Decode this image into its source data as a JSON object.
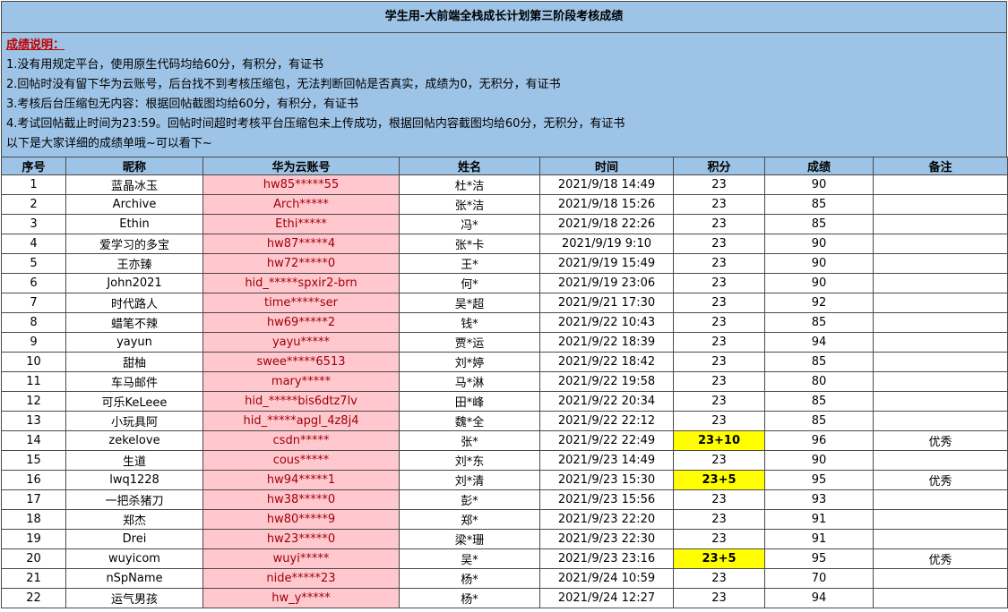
{
  "title": "学生用-大前端全栈成长计划第三阶段考核成绩",
  "notes": {
    "heading": "成绩说明：",
    "lines": [
      "1.没有用规定平台，使用原生代码均给60分，有积分，有证书",
      "2.回帖时没有留下华为云账号，后台找不到考核压缩包，无法判断回帖是否真实，成绩为0，无积分，有证书",
      "3.考核后台压缩包无内容：根据回帖截图均给60分，有积分，有证书",
      "4.考试回帖截止时间为23:59。回帖时间超时考核平台压缩包未上传成功，根据回帖内容截图均给60分，无积分，有证书",
      "以下是大家详细的成绩单哦~可以看下~"
    ]
  },
  "columns": [
    "序号",
    "昵称",
    "华为云账号",
    "姓名",
    "时间",
    "积分",
    "成绩",
    "备注"
  ],
  "rows": [
    {
      "no": "1",
      "nick": "蓝晶冰玉",
      "account": "hw85*****55",
      "name": "杜*洁",
      "time": "2021/9/18 14:49",
      "points": "23",
      "score": "90",
      "remark": ""
    },
    {
      "no": "2",
      "nick": "Archive",
      "account": "Arch*****",
      "name": "张*洁",
      "time": "2021/9/18 15:26",
      "points": "23",
      "score": "85",
      "remark": ""
    },
    {
      "no": "3",
      "nick": "Ethin",
      "account": "Ethi*****",
      "name": "冯*",
      "time": "2021/9/18 22:26",
      "points": "23",
      "score": "85",
      "remark": ""
    },
    {
      "no": "4",
      "nick": "爱学习的多宝",
      "account": "hw87*****4",
      "name": "张*卡",
      "time": "2021/9/19 9:10",
      "points": "23",
      "score": "90",
      "remark": ""
    },
    {
      "no": "5",
      "nick": "王亦臻",
      "account": "hw72*****0",
      "name": "王*",
      "time": "2021/9/19 15:49",
      "points": "23",
      "score": "90",
      "remark": ""
    },
    {
      "no": "6",
      "nick": "John2021",
      "account": "hid_*****spxir2-brn",
      "name": "何*",
      "time": "2021/9/19 23:06",
      "points": "23",
      "score": "90",
      "remark": ""
    },
    {
      "no": "7",
      "nick": "时代路人",
      "account": "time*****ser",
      "name": "吴*超",
      "time": "2021/9/21 17:30",
      "points": "23",
      "score": "92",
      "remark": ""
    },
    {
      "no": "8",
      "nick": "蜡笔不辣",
      "account": "hw69*****2",
      "name": "钱*",
      "time": "2021/9/22 10:43",
      "points": "23",
      "score": "85",
      "remark": ""
    },
    {
      "no": "9",
      "nick": "yayun",
      "account": "yayu*****",
      "name": "贾*运",
      "time": "2021/9/22 18:39",
      "points": "23",
      "score": "94",
      "remark": ""
    },
    {
      "no": "10",
      "nick": "甜柚",
      "account": "swee*****6513",
      "name": "刘*婷",
      "time": "2021/9/22 18:42",
      "points": "23",
      "score": "85",
      "remark": ""
    },
    {
      "no": "11",
      "nick": "车马邮件",
      "account": "mary*****",
      "name": "马*淋",
      "time": "2021/9/22 19:58",
      "points": "23",
      "score": "80",
      "remark": ""
    },
    {
      "no": "12",
      "nick": "可乐KeLeee",
      "account": "hid_*****bis6dtz7lv",
      "name": "田*峰",
      "time": "2021/9/22 20:34",
      "points": "23",
      "score": "85",
      "remark": ""
    },
    {
      "no": "13",
      "nick": "小玩具阿",
      "account": "hid_*****apgl_4z8j4",
      "name": "魏*全",
      "time": "2021/9/22 22:12",
      "points": "23",
      "score": "85",
      "remark": ""
    },
    {
      "no": "14",
      "nick": "zekelove",
      "account": "csdn*****",
      "name": "张*",
      "time": "2021/9/22 22:49",
      "points": "23+10",
      "score": "96",
      "remark": "优秀",
      "highlight": true
    },
    {
      "no": "15",
      "nick": "生道",
      "account": "cous*****",
      "name": "刘*东",
      "time": "2021/9/23 14:49",
      "points": "23",
      "score": "90",
      "remark": ""
    },
    {
      "no": "16",
      "nick": "lwq1228",
      "account": "hw94*****1",
      "name": "刘*清",
      "time": "2021/9/23 15:30",
      "points": "23+5",
      "score": "95",
      "remark": "优秀",
      "highlight": true
    },
    {
      "no": "17",
      "nick": "一把杀猪刀",
      "account": "hw38*****0",
      "name": "彭*",
      "time": "2021/9/23 15:56",
      "points": "23",
      "score": "93",
      "remark": ""
    },
    {
      "no": "18",
      "nick": "郑杰",
      "account": "hw80*****9",
      "name": "郑*",
      "time": "2021/9/23 22:20",
      "points": "23",
      "score": "91",
      "remark": ""
    },
    {
      "no": "19",
      "nick": "Drei",
      "account": "hw23*****0",
      "name": "梁*珊",
      "time": "2021/9/23 22:30",
      "points": "23",
      "score": "91",
      "remark": ""
    },
    {
      "no": "20",
      "nick": "wuyicom",
      "account": "wuyi*****",
      "name": "吴*",
      "time": "2021/9/23 23:16",
      "points": "23+5",
      "score": "95",
      "remark": "优秀",
      "highlight": true
    },
    {
      "no": "21",
      "nick": "nSpName",
      "account": "nide*****23",
      "name": "杨*",
      "time": "2021/9/24 10:59",
      "points": "23",
      "score": "70",
      "remark": ""
    },
    {
      "no": "22",
      "nick": "运气男孩",
      "account": "hw_y*****",
      "name": "杨*",
      "time": "2021/9/24 12:27",
      "points": "23",
      "score": "94",
      "remark": ""
    }
  ]
}
